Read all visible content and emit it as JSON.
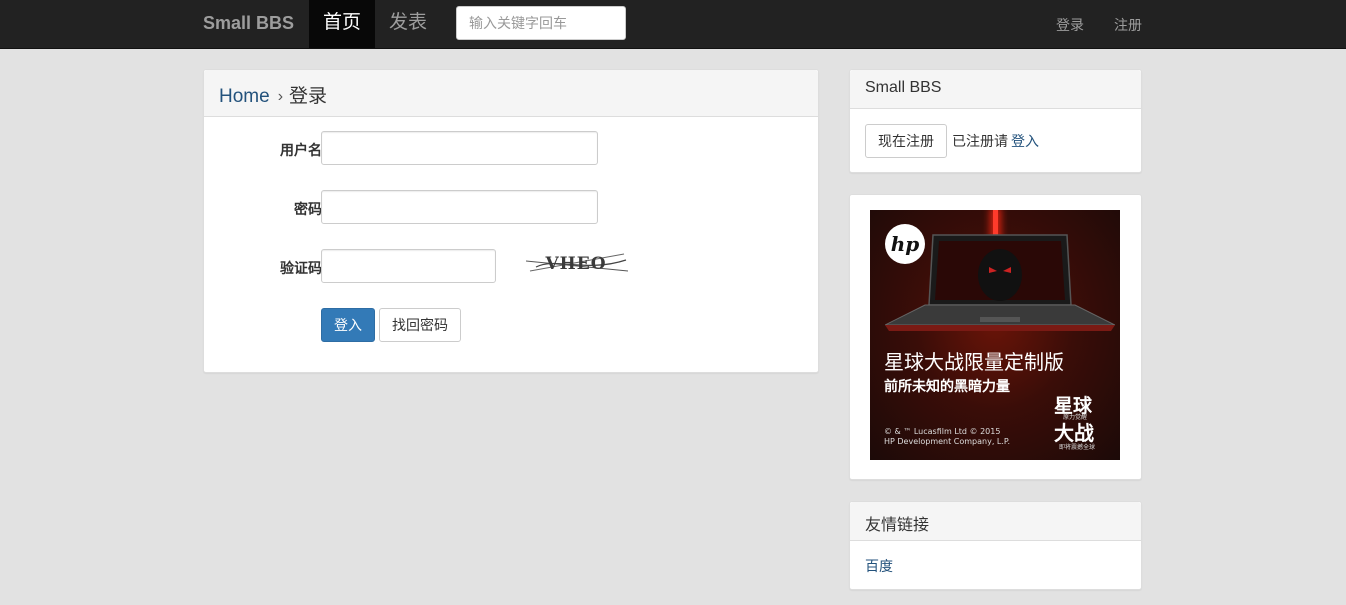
{
  "navbar": {
    "brand": "Small BBS",
    "items": [
      {
        "label": "首页",
        "active": true
      },
      {
        "label": "发表",
        "active": false
      }
    ],
    "search_placeholder": "输入关键字回车",
    "login": "登录",
    "register": "注册"
  },
  "breadcrumb": {
    "home": "Home",
    "separator": "›",
    "current": "登录"
  },
  "form": {
    "username_label": "用户名",
    "password_label": "密码",
    "captcha_label": "验证码",
    "captcha_text": "VHEO",
    "submit": "登入",
    "recover": "找回密码"
  },
  "sidebar": {
    "title": "Small BBS",
    "register_now": "现在注册",
    "already_registered": "已注册请",
    "login_link": "登入",
    "ad": {
      "headline": "星球大战限量定制版",
      "subline": "前所未知的黑暗力量",
      "copyright_1": "© & ™ Lucasfilm Ltd © 2015",
      "copyright_2": "HP Development Company, L.P.",
      "logo": "hp",
      "sw_top": "星球",
      "sw_mid": "原力觉醒",
      "sw_bottom": "大战",
      "sw_note": "即将震撼全球"
    },
    "links_title": "友情链接",
    "links": [
      "百度"
    ]
  },
  "colors": {
    "navbar_bg": "#222222",
    "accent": "#337ab7",
    "link": "#23527c",
    "page_bg": "#e2e2e2"
  }
}
